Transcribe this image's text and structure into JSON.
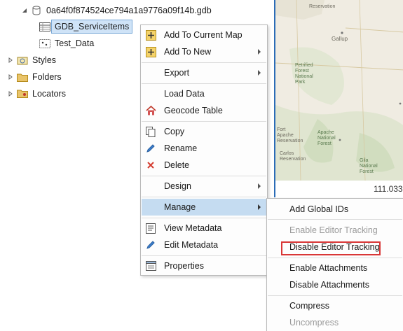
{
  "tree": {
    "gdb_label": "0a64f0f874524ce794a1a9776a09f14b.gdb",
    "items": [
      {
        "label": "GDB_ServiceItems"
      },
      {
        "label": "Test_Data"
      }
    ],
    "folders": [
      {
        "label": "Styles"
      },
      {
        "label": "Folders"
      },
      {
        "label": "Locators"
      }
    ]
  },
  "map": {
    "labels": [
      "Reservation",
      "Gallup",
      "Petrified Forest National Park",
      "Fort Apache Reservation",
      "Apache National Forest",
      "Gila National Forest",
      "Carlos Reservation"
    ],
    "coordinate": "111.0330"
  },
  "context_menu": {
    "items": [
      {
        "label": "Add To Current Map",
        "icon": "add-layer-icon"
      },
      {
        "label": "Add To New",
        "icon": "add-layer-icon",
        "submenu": true
      },
      {
        "label": "Export",
        "submenu": true
      },
      {
        "label": "Load Data"
      },
      {
        "label": "Geocode Table",
        "icon": "geocode-icon"
      },
      {
        "label": "Copy",
        "icon": "copy-icon"
      },
      {
        "label": "Rename",
        "icon": "pencil-icon"
      },
      {
        "label": "Delete",
        "icon": "delete-icon"
      },
      {
        "label": "Design",
        "submenu": true
      },
      {
        "label": "Manage",
        "submenu": true,
        "active": true
      },
      {
        "label": "View Metadata",
        "icon": "view-metadata-icon"
      },
      {
        "label": "Edit Metadata",
        "icon": "pencil-icon"
      },
      {
        "label": "Properties",
        "icon": "properties-icon"
      }
    ]
  },
  "manage_submenu": {
    "items": [
      {
        "label": "Add Global IDs",
        "enabled": true
      },
      {
        "label": "Enable Editor Tracking",
        "enabled": false
      },
      {
        "label": "Disable Editor Tracking",
        "enabled": true,
        "highlighted": true
      },
      {
        "label": "Enable Attachments",
        "enabled": true
      },
      {
        "label": "Disable Attachments",
        "enabled": true
      },
      {
        "label": "Compress",
        "enabled": true
      },
      {
        "label": "Uncompress",
        "enabled": false
      }
    ]
  },
  "colors": {
    "selection": "#c5dcf1",
    "highlight_border": "#d93636",
    "map_border": "#2b6cb7"
  }
}
